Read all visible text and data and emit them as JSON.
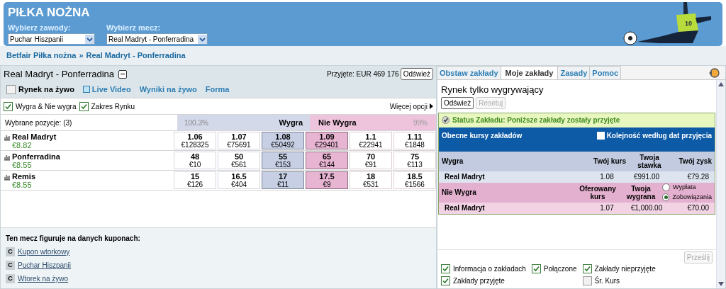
{
  "header": {
    "title": "PIŁKA NOŻNA",
    "selects": [
      {
        "label": "Wybierz zawody:",
        "value": "Puchar Hiszpanii"
      },
      {
        "label": "Wybierz mecz:",
        "value": "Real Madryt - Ponferradina"
      }
    ],
    "jersey_number": "10"
  },
  "breadcrumb": {
    "items": [
      "Betfair Piłka nożna",
      "Real Madryt - Ponferradina"
    ],
    "separator": "»"
  },
  "market": {
    "title": "Real Madryt - Ponferradina",
    "accepted": "Przyjęte: EUR 469 176",
    "refresh": "Odśwież",
    "live_market": {
      "label": "Rynek na żywo",
      "checked": false
    },
    "links": [
      {
        "label": "Live Video",
        "kind": "video"
      },
      {
        "label": "Wyniki na żywo",
        "kind": "plain"
      },
      {
        "label": "Forma",
        "kind": "plain"
      }
    ],
    "filters": [
      {
        "label": "Wygra & Nie wygra",
        "checked": true
      },
      {
        "label": "Zakres Rynku",
        "checked": true
      }
    ],
    "more_options": "Więcej opcji",
    "selected_label": "Wybrane pozycje:  (3)",
    "back_pct": "100.3%",
    "back_label": "Wygra",
    "lay_label": "Nie Wygra",
    "lay_pct": "99%",
    "runners": [
      {
        "name": "Real Madryt",
        "pl": "€8.82",
        "odds": [
          {
            "kind": "back",
            "best": false,
            "price": "1.06",
            "size": "€128325"
          },
          {
            "kind": "back",
            "best": false,
            "price": "1.07",
            "size": "€75691"
          },
          {
            "kind": "back",
            "best": true,
            "price": "1.08",
            "size": "€50492"
          },
          {
            "kind": "lay",
            "best": true,
            "price": "1.09",
            "size": "€29401"
          },
          {
            "kind": "lay",
            "best": false,
            "price": "1.1",
            "size": "€22941"
          },
          {
            "kind": "lay",
            "best": false,
            "price": "1.11",
            "size": "€1848"
          }
        ]
      },
      {
        "name": "Ponferradina",
        "pl": "€8.55",
        "odds": [
          {
            "kind": "back",
            "best": false,
            "price": "48",
            "size": "€10"
          },
          {
            "kind": "back",
            "best": false,
            "price": "50",
            "size": "€561"
          },
          {
            "kind": "back",
            "best": true,
            "price": "55",
            "size": "€153"
          },
          {
            "kind": "lay",
            "best": true,
            "price": "65",
            "size": "€144"
          },
          {
            "kind": "lay",
            "best": false,
            "price": "70",
            "size": "€91"
          },
          {
            "kind": "lay",
            "best": false,
            "price": "75",
            "size": "€113"
          }
        ]
      },
      {
        "name": "Remis",
        "pl": "€8.55",
        "odds": [
          {
            "kind": "back",
            "best": false,
            "price": "15",
            "size": "€126"
          },
          {
            "kind": "back",
            "best": false,
            "price": "16.5",
            "size": "€404"
          },
          {
            "kind": "back",
            "best": true,
            "price": "17",
            "size": "€11"
          },
          {
            "kind": "lay",
            "best": true,
            "price": "17.5",
            "size": "€9"
          },
          {
            "kind": "lay",
            "best": false,
            "price": "18",
            "size": "€531"
          },
          {
            "kind": "lay",
            "best": false,
            "price": "18.5",
            "size": "€1566"
          }
        ]
      }
    ]
  },
  "coupons": {
    "title": "Ten mecz figuruje na danych kuponach:",
    "items": [
      {
        "badge": "C",
        "label": "Kupon wtorkowy"
      },
      {
        "badge": "C",
        "label": "Puchar Hiszpanii"
      },
      {
        "badge": "C",
        "label": "Wtorek na żywo"
      }
    ]
  },
  "betslip": {
    "tabs": [
      {
        "label": "Obstaw zakłady",
        "selected": false
      },
      {
        "label": "Moje zakłady",
        "selected": true
      },
      {
        "label": "Zasady",
        "selected": false
      },
      {
        "label": "Pomoc",
        "selected": false
      }
    ],
    "heading": "Rynek tylko wygrywający",
    "buttons": [
      {
        "label": "Odśwież",
        "disabled": false
      },
      {
        "label": "Resetuj",
        "disabled": true
      }
    ],
    "status": "Status Zakładu: Poniższe zakłady zostały przyjęte",
    "current_title": "Obecne kursy zakładów",
    "order": {
      "label": "Kolejność według dat przyjęcia",
      "checked": false
    },
    "back": {
      "title": "Wygra",
      "columns": [
        "Twój kurs",
        "Twoja stawka",
        "Twój zysk"
      ],
      "rows": [
        {
          "name": "Real Madryt",
          "cells": [
            "1.08",
            "€991.00",
            "€79.28"
          ]
        }
      ]
    },
    "lay": {
      "title": "Nie Wygra",
      "columns": [
        "Oferowany kurs",
        "Twoja wygrana"
      ],
      "radios": [
        {
          "label": "Wypłata",
          "selected": false
        },
        {
          "label": "Zobowiązania",
          "selected": true
        }
      ],
      "rows": [
        {
          "name": "Real Madryt",
          "cells": [
            "1.07",
            "€1,000.00",
            "€70.00"
          ]
        }
      ]
    },
    "submit": {
      "label": "Prześlij",
      "disabled": true
    },
    "options": [
      [
        {
          "label": "Informacja o zakładach",
          "checked": true
        },
        {
          "label": "Zakłady przyjęte",
          "checked": true
        }
      ],
      [
        {
          "label": "Połączone",
          "checked": true
        }
      ],
      [
        {
          "label": "Zakłady nieprzyjęte",
          "checked": true
        },
        {
          "label": "Śr. Kurs",
          "checked": false
        }
      ]
    ]
  }
}
